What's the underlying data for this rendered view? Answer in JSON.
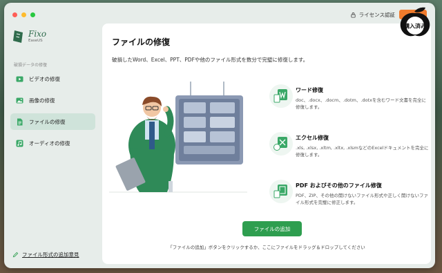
{
  "window": {
    "license_label": "ライセンス認証"
  },
  "sidebar": {
    "logo_name": "Fixo",
    "logo_sub": "EaseUS",
    "section_label": "破損データの修復",
    "items": [
      {
        "label": "ビデオの修復",
        "icon": "video-icon"
      },
      {
        "label": "画像の修復",
        "icon": "image-icon"
      },
      {
        "label": "ファイルの修復",
        "icon": "file-icon",
        "active": true
      },
      {
        "label": "オーディオの修復",
        "icon": "audio-icon"
      }
    ],
    "footer_label": "ファイル形式の追加意見"
  },
  "main": {
    "title": "ファイルの修復",
    "description": "破損したWord、Excel、PPT、PDFや他のファイル形式を数分で完璧に修復します。",
    "features": [
      {
        "title": "ワード修復",
        "desc": "doc、.docx、.docm、.dotm、.dotxを含むワード文書を完全に修復します。",
        "icon": "word-icon"
      },
      {
        "title": "エクセル修復",
        "desc": ".xls, .xlsx, .xltm, .xltx, .xlsmなどのExcelドキュメントを完全に修復します。",
        "icon": "excel-icon"
      },
      {
        "title": "PDF およびその他のファイル修復",
        "desc": "PDF、ZIP、その他の開けないファイル形式や正しく開けないファイル形式を完璧に修正します。",
        "icon": "pdf-icon"
      }
    ],
    "add_button": "ファイルの追加",
    "hint": "「ファイルの追加」ボタンをクリックするか、ここにファイルをドラッグ＆ドロップしてください"
  },
  "badge": {
    "text": "購入済み"
  },
  "colors": {
    "accent": "#2e9e4f",
    "sidebar_active": "#cfe3da",
    "buy_button": "#f07b2c"
  }
}
